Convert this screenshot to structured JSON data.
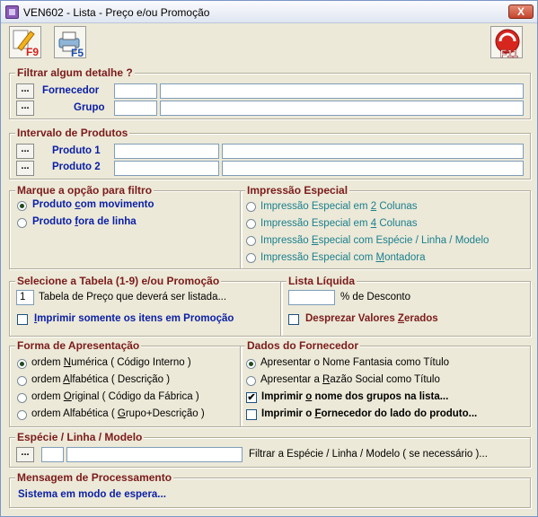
{
  "window": {
    "title": "VEN602 - Lista - Preço e/ou Promoção",
    "close_label": "X"
  },
  "toolbar": {
    "f9": "F9",
    "f5": "F5",
    "f11": "F11"
  },
  "filter": {
    "legend": "Filtrar algum detalhe ?",
    "fornecedor_label": "Fornecedor",
    "grupo_label": "Grupo",
    "dots": "..."
  },
  "intervalo": {
    "legend": "Intervalo de Produtos",
    "produto1_label": "Produto 1",
    "produto2_label": "Produto 2"
  },
  "marque": {
    "legend": "Marque a opção para filtro",
    "options": [
      {
        "pre": "Produto ",
        "u": "c",
        "post": "om movimento",
        "checked": true
      },
      {
        "pre": "Produto ",
        "u": "f",
        "post": "ora de linha",
        "checked": false
      }
    ]
  },
  "impressao": {
    "legend": "Impressão Especial",
    "options": [
      {
        "pre": "Impressão Especial em ",
        "u": "2",
        "post": " Colunas"
      },
      {
        "pre": "Impressão Especial em ",
        "u": "4",
        "post": " Colunas"
      },
      {
        "pre": "Impressão ",
        "u": "E",
        "post": "special com Espécie / Linha / Modelo"
      },
      {
        "pre": "Impressão Especial com ",
        "u": "M",
        "post": "ontadora"
      }
    ]
  },
  "tabela": {
    "legend": "Selecione a Tabela (1-9) e/ou Promoção",
    "value": "1",
    "desc": "Tabela de Preço que deverá ser listada...",
    "promo_pre": "",
    "promo_u": "I",
    "promo_post": "mprimir somente os itens em Promoção"
  },
  "lista": {
    "legend": "Lista Líquida",
    "desconto_label": "% de Desconto",
    "zerados_pre": "Desprezar Valores ",
    "zerados_u": "Z",
    "zerados_post": "erados"
  },
  "forma": {
    "legend": "Forma de Apresentação",
    "options": [
      {
        "pre": "ordem ",
        "u": "N",
        "post": "umérica ( Código Interno )",
        "checked": true
      },
      {
        "pre": "ordem ",
        "u": "A",
        "post": "lfabética ( Descrição )",
        "checked": false
      },
      {
        "pre": "ordem ",
        "u": "O",
        "post": "riginal ( Código da Fábrica )",
        "checked": false
      },
      {
        "pre": "ordem Alfabética ( ",
        "u": "G",
        "post": "rupo+Descrição )",
        "checked": false
      }
    ]
  },
  "dados": {
    "legend": "Dados do Fornecedor",
    "radio1": "Apresentar o Nome Fantasia como Título",
    "radio2_pre": "Apresentar a ",
    "radio2_u": "R",
    "radio2_post": "azão Social como Título",
    "chk1_pre": "Imprimir ",
    "chk1_u": "o",
    "chk1_post": " nome dos grupos na lista...",
    "chk1_checked": true,
    "chk2_pre": "Imprimir o ",
    "chk2_u": "F",
    "chk2_post": "ornecedor do lado do produto...",
    "chk2_checked": false
  },
  "especie": {
    "legend": "Espécie / Linha / Modelo",
    "hint": "Filtrar a Espécie / Linha / Modelo ( se necessário )..."
  },
  "mensagem": {
    "legend": "Mensagem de Processamento",
    "text": "Sistema em modo de espera..."
  }
}
